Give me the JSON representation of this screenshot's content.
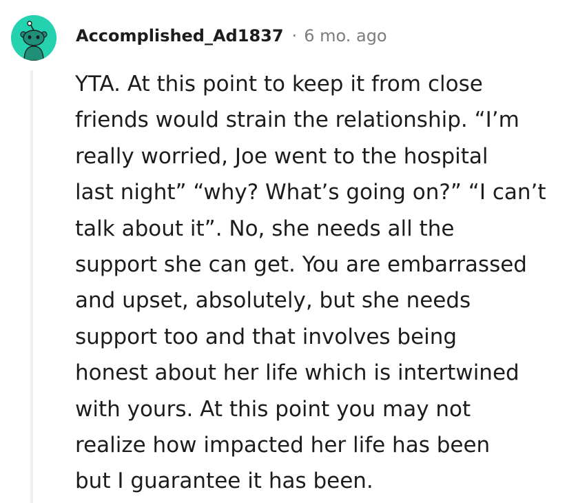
{
  "comment": {
    "author": "Accomplished_Ad1837",
    "separator": "·",
    "timestamp": "6 mo. ago",
    "avatar_icon": "snoo-avatar-icon",
    "avatar_color": "#24d2b0",
    "text": "YTA. At this point to keep it from close\nfriends would strain the relationship. “I’m\nreally worried, Joe went to the hospital\nlast night” “why? What’s going on?” “I can’t\ntalk about it”. No, she needs all the\nsupport she can get. You are embarrassed\nand upset, absolutely, but she needs\nsupport too and that involves being\nhonest about her life which is intertwined\nwith yours. At this point you may not\nrealize how impacted her life has been\nbut I guarantee it has been."
  }
}
